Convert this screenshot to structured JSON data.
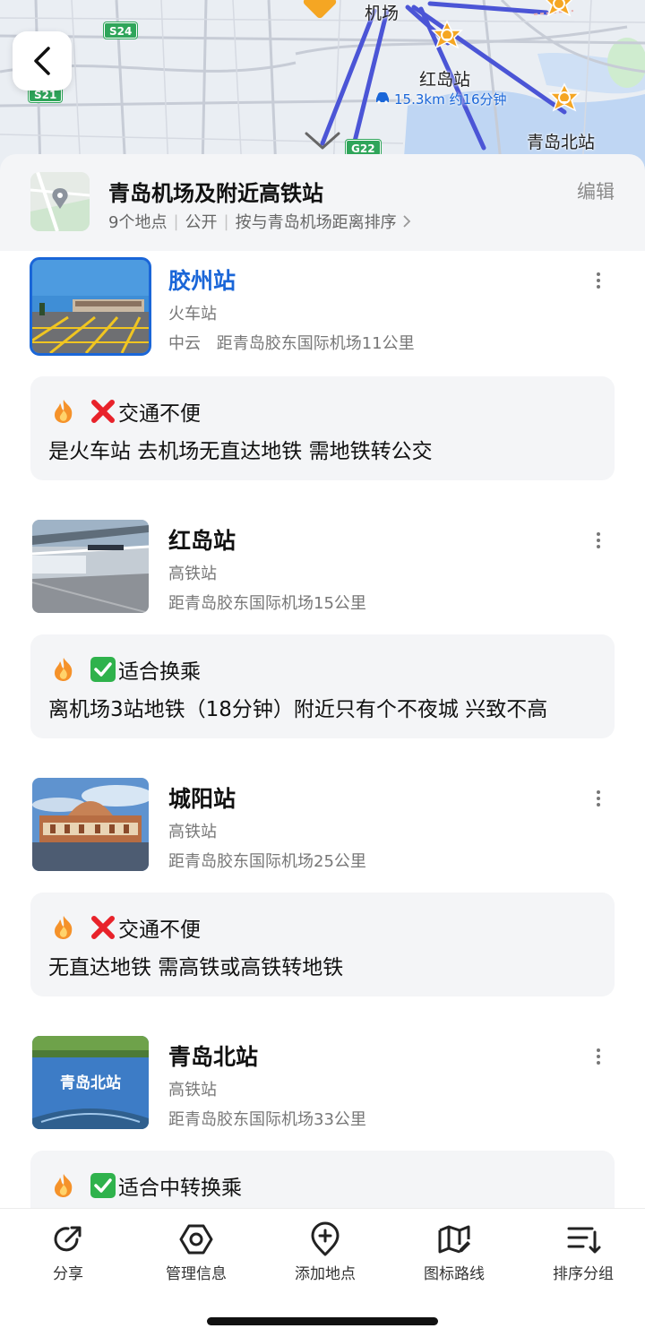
{
  "map": {
    "labels": {
      "airport": "机场",
      "hongdao": "红岛站",
      "qingdao_north": "青岛北站"
    },
    "route_info": "15.3km 约16分钟",
    "road_shields": [
      "S24",
      "S21",
      "G22"
    ]
  },
  "header": {
    "title": "青岛机场及附近高铁站",
    "count": "9个地点",
    "visibility": "公开",
    "sort": "按与青岛机场距离排序",
    "edit": "编辑"
  },
  "places": [
    {
      "name": "胶州站",
      "category": "火车站",
      "area": "中云",
      "distance": "距青岛胶东国际机场11公里",
      "selected": true,
      "note_status": "不便",
      "note_title": "交通不便",
      "note_body": "是火车站 去机场无直达地铁 需地铁转公交"
    },
    {
      "name": "红岛站",
      "category": "高铁站",
      "area": "",
      "distance": "距青岛胶东国际机场15公里",
      "selected": false,
      "note_status": "适合",
      "note_title": "适合换乘",
      "note_body": "离机场3站地铁（18分钟）附近只有个不夜城 兴致不高"
    },
    {
      "name": "城阳站",
      "category": "高铁站",
      "area": "",
      "distance": "距青岛胶东国际机场25公里",
      "selected": false,
      "note_status": "不便",
      "note_title": "交通不便",
      "note_body": "无直达地铁 需高铁或高铁转地铁"
    },
    {
      "name": "青岛北站",
      "category": "高铁站",
      "area": "",
      "distance": "距青岛胶东国际机场33公里",
      "selected": false,
      "note_status": "适合",
      "note_title": "适合中转换乘",
      "note_body": ""
    }
  ],
  "thumb_caption_north": "青岛北站",
  "toolbar": {
    "share": "分享",
    "manage": "管理信息",
    "add": "添加地点",
    "route": "图标路线",
    "sort": "排序分组"
  },
  "colors": {
    "accent": "#1a66d8",
    "route": "#4b55d6",
    "marker": "#f5a623",
    "bad": "#e8222a",
    "good": "#2fb24c"
  }
}
